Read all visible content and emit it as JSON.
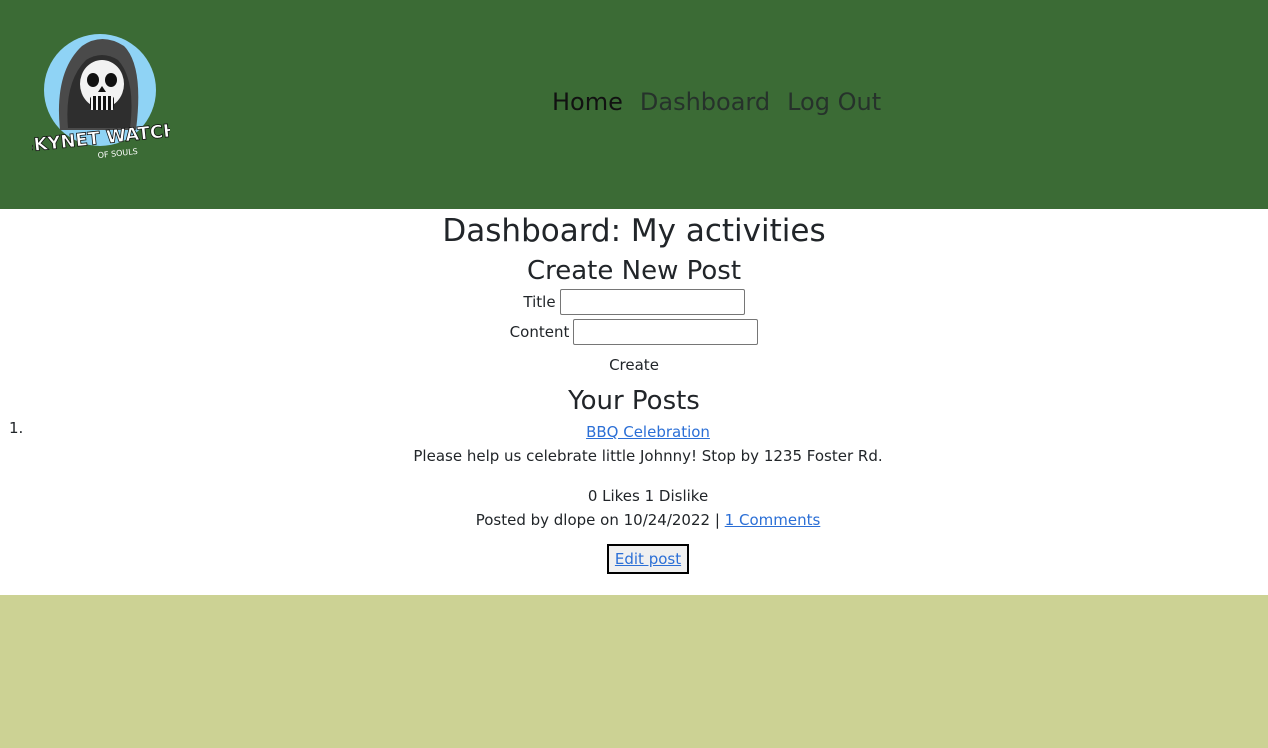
{
  "header": {
    "logo_text": "SKYNET WATCH",
    "logo_subtext": "OF SOULS",
    "nav": [
      {
        "label": "Home"
      },
      {
        "label": "Dashboard"
      },
      {
        "label": "Log Out"
      }
    ]
  },
  "page": {
    "title": "Dashboard: My activities",
    "create": {
      "heading": "Create New Post",
      "title_label": "Title",
      "title_value": "",
      "content_label": "Content",
      "content_value": "",
      "button": "Create"
    },
    "posts_heading": "Your Posts",
    "posts": [
      {
        "number": "1.",
        "title": "BBQ Celebration",
        "content": "Please help us celebrate little Johnny! Stop by 1235 Foster Rd.",
        "votes": "0 Likes 1 Dislike",
        "byline": "Posted by dlope on 10/24/2022 |",
        "comments_link": "1 Comments",
        "edit": "Edit post"
      }
    ]
  },
  "colors": {
    "header_bg": "#3b6b35",
    "footer_bg": "#ccd294",
    "link": "#2b6fd6"
  }
}
